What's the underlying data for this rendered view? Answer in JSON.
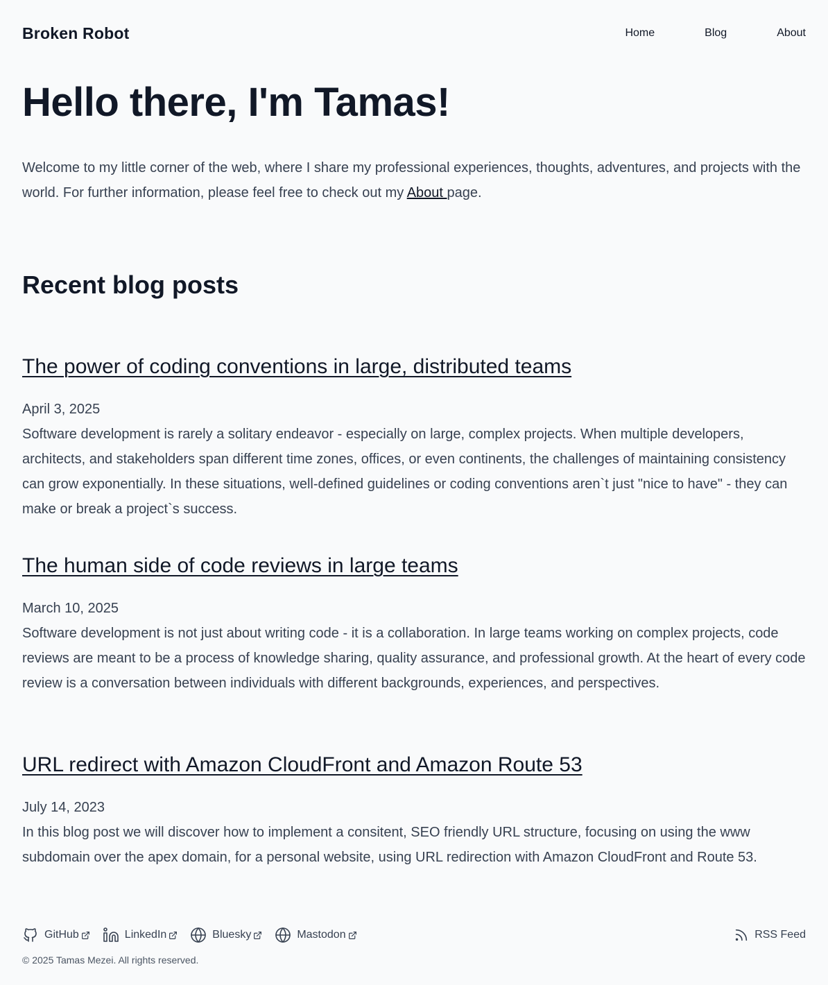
{
  "header": {
    "site_title": "Broken Robot",
    "nav": [
      {
        "label": "Home"
      },
      {
        "label": "Blog"
      },
      {
        "label": "About"
      }
    ]
  },
  "hero": {
    "title": "Hello there, I'm Tamas!",
    "intro_before": "Welcome to my little corner of the web, where I share my professional experiences, thoughts, adventures, and projects with the world. For further information, please feel free to check out my ",
    "intro_link": "About ",
    "intro_after": "page."
  },
  "recent": {
    "title": "Recent blog posts",
    "posts": [
      {
        "title": "The power of coding conventions in large, distributed teams",
        "date": "April 3, 2025",
        "summary": "Software development is rarely a solitary endeavor - especially on large, complex projects. When multiple developers, architects, and stakeholders span different time zones, offices, or even continents, the challenges of maintaining consistency can grow exponentially. In these situations, well-defined guidelines or coding conventions aren`t just \"nice to have\" - they can make or break a project`s success."
      },
      {
        "title": "The human side of code reviews in large teams",
        "date": "March 10, 2025",
        "summary": "Software development is not just about writing code - it is a collaboration. In large teams working on complex projects, code reviews are meant to be a process of knowledge sharing, quality assurance, and professional growth. At the heart of every code review is a conversation between individuals with different backgrounds, experiences, and perspectives."
      },
      {
        "title": "URL redirect with Amazon CloudFront and Amazon Route 53",
        "date": "July 14, 2023",
        "summary": "In this blog post we will discover how to implement a consitent, SEO friendly URL structure, focusing on using the www subdomain over the apex domain, for a personal website, using URL redirection with Amazon CloudFront and Route 53."
      }
    ]
  },
  "footer": {
    "social": [
      {
        "label": "GitHub",
        "icon": "github-icon"
      },
      {
        "label": "LinkedIn",
        "icon": "linkedin-icon"
      },
      {
        "label": "Bluesky",
        "icon": "globe-icon"
      },
      {
        "label": "Mastodon",
        "icon": "globe-icon"
      }
    ],
    "rss_label": "RSS Feed",
    "copyright": "© 2025 Tamas Mezei. All rights reserved."
  }
}
